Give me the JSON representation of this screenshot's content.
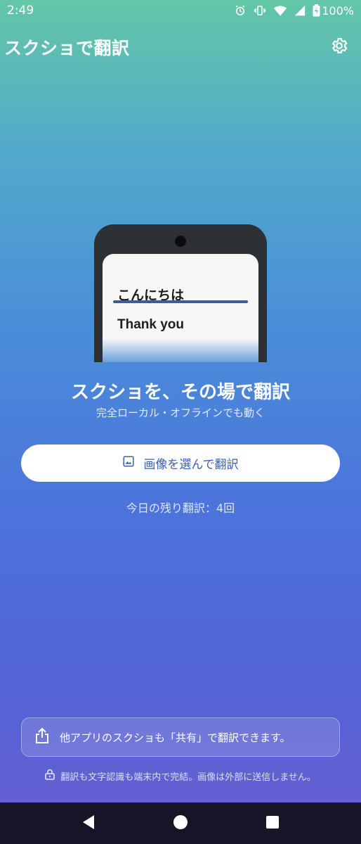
{
  "status_bar": {
    "time": "2:49",
    "battery": "100%",
    "icons": [
      "alarm-icon",
      "vibrate-icon",
      "wifi-icon",
      "signal-icon",
      "battery-icon"
    ]
  },
  "app_bar": {
    "title": "スクショで翻訳",
    "settings_icon": "gear-icon"
  },
  "illustration": {
    "japanese_text": "こんにちは",
    "english_text": "Thank you"
  },
  "hero": {
    "headline": "スクショを、その場で翻訳",
    "subheadline": "完全ローカル・オフラインでも動く"
  },
  "select_button": {
    "label": "画像を選んで翻訳",
    "icon": "image-icon"
  },
  "remaining": {
    "text": "今日の残り翻訳：4回"
  },
  "share_hint": {
    "text": "他アプリのスクショも「共有」で翻訳できます。",
    "icon": "share-icon"
  },
  "privacy_note": {
    "text": "翻訳も文字認識も端末内で完結。画像は外部に送信しません。",
    "icon": "lock-icon"
  },
  "nav_bar": {
    "buttons": [
      "back-icon",
      "home-icon",
      "recents-icon"
    ]
  },
  "colors": {
    "accent": "#3b5fb6",
    "nav_background": "#161427",
    "gradient_top": "#63c7a6",
    "gradient_bottom": "#6a5fcf"
  }
}
